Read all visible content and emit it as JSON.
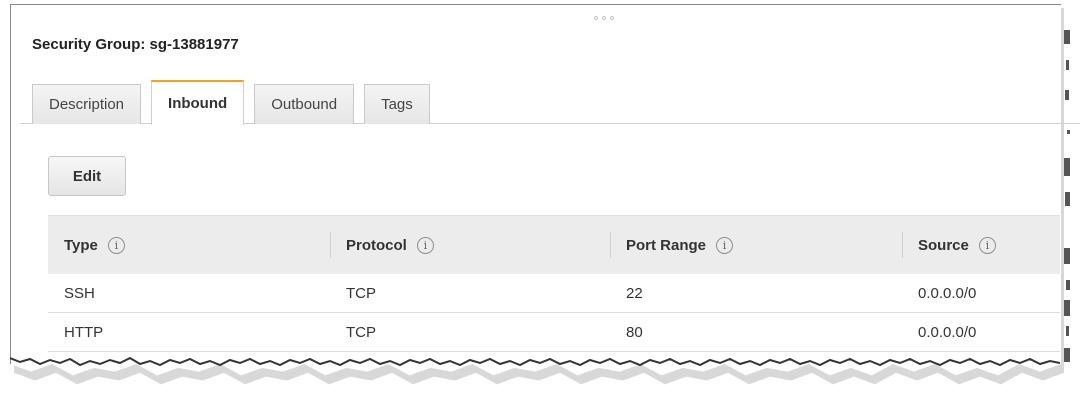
{
  "header": {
    "title": "Security Group: sg-13881977"
  },
  "tabs": [
    {
      "label": "Description",
      "active": false
    },
    {
      "label": "Inbound",
      "active": true
    },
    {
      "label": "Outbound",
      "active": false
    },
    {
      "label": "Tags",
      "active": false
    }
  ],
  "toolbar": {
    "edit_label": "Edit"
  },
  "table": {
    "columns": [
      "Type",
      "Protocol",
      "Port Range",
      "Source"
    ],
    "info_glyph": "i",
    "rows": [
      {
        "type": "SSH",
        "protocol": "TCP",
        "port_range": "22",
        "source": "0.0.0.0/0"
      },
      {
        "type": "HTTP",
        "protocol": "TCP",
        "port_range": "80",
        "source": "0.0.0.0/0"
      }
    ]
  },
  "colors": {
    "active_tab_accent": "#f0a22d",
    "header_bg": "#ececec"
  },
  "icons": {
    "info": "info-circle-icon",
    "drag": "drag-handle-icon"
  }
}
